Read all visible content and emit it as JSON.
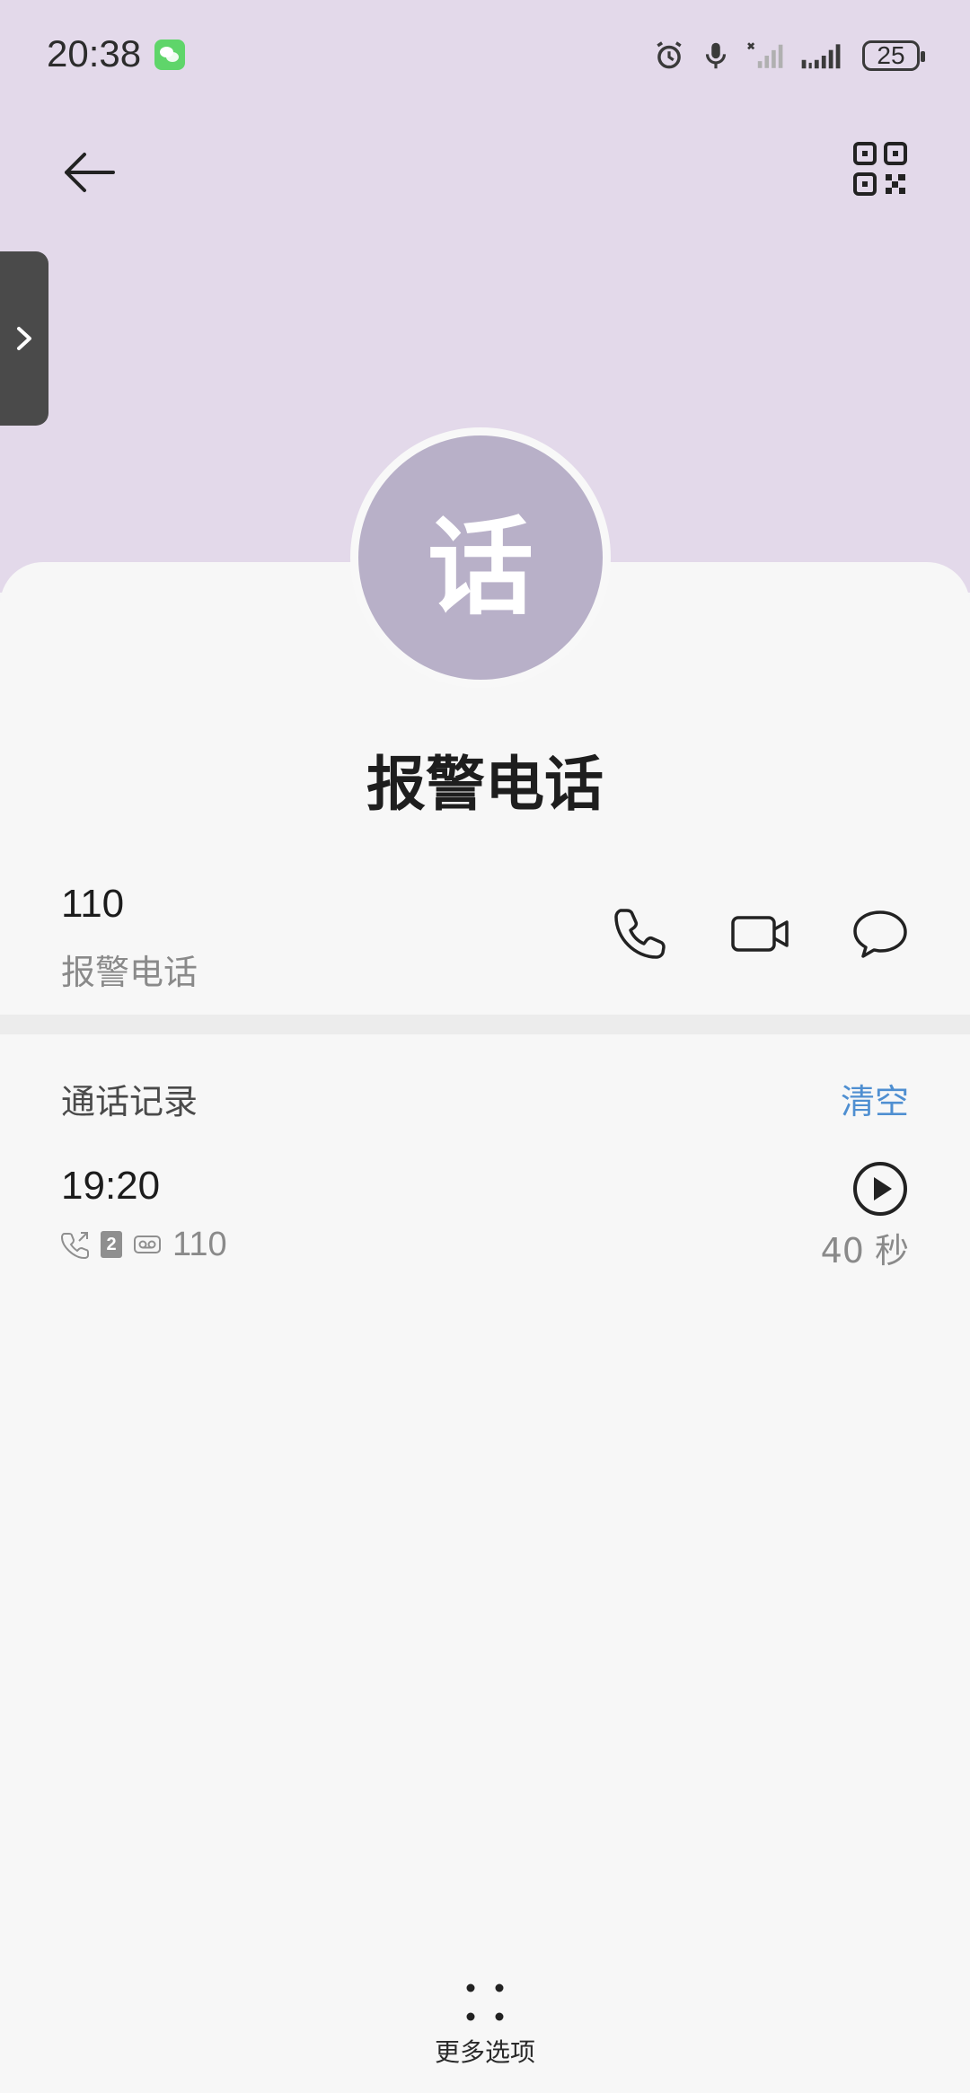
{
  "status_bar": {
    "time": "20:38",
    "battery_level": "25",
    "icons": [
      "wechat-icon",
      "alarm-icon",
      "microphone-icon",
      "signal-sim1-icon",
      "signal-sim2-icon",
      "battery-icon"
    ]
  },
  "header": {
    "back_icon": "arrow-left-icon",
    "qr_icon": "qr-code-icon"
  },
  "contact": {
    "avatar_char": "话",
    "avatar_color": "#b8b0c8",
    "name": "报警电话"
  },
  "phone": {
    "number": "110",
    "label": "报警电话",
    "actions": [
      "phone-icon",
      "video-call-icon",
      "message-icon"
    ]
  },
  "call_history": {
    "title": "通话记录",
    "clear_label": "清空",
    "entries": [
      {
        "time": "19:20",
        "sim": "2",
        "number": "110",
        "duration": "40 秒"
      }
    ]
  },
  "footer": {
    "more_label": "更多选项"
  },
  "colors": {
    "header_bg": "#e3d9ea",
    "accent": "#4f8fd1"
  }
}
